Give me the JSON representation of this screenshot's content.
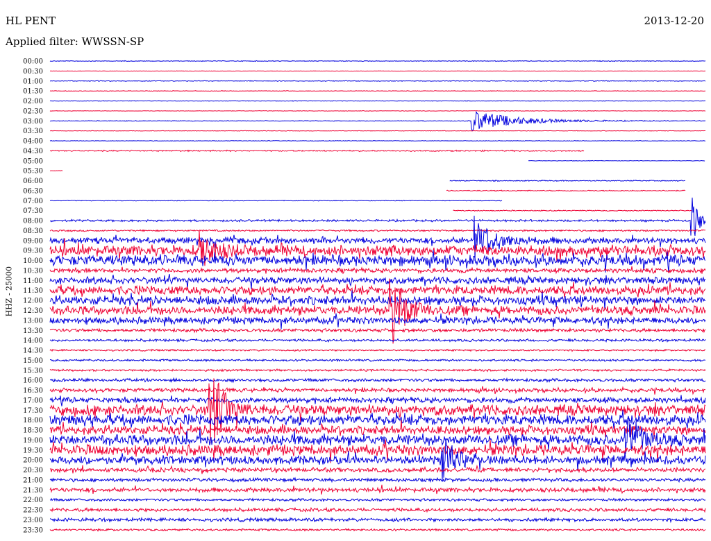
{
  "header": {
    "station": "HL PENT",
    "date": "2013-12-20",
    "filter": "Applied filter: WWSSN-SP"
  },
  "chart_data": {
    "type": "helicorder",
    "ylabel": "HHZ - 25000",
    "colors": {
      "even": "#0000dd",
      "odd": "#ee0033"
    },
    "rows": [
      {
        "label": "00:00",
        "start": 0.0,
        "end": 1.0,
        "level": 0.4
      },
      {
        "label": "00:30",
        "start": 0.0,
        "end": 1.0,
        "level": 0.2
      },
      {
        "label": "01:00",
        "start": 0.0,
        "end": 1.0,
        "level": 0.4
      },
      {
        "label": "01:30",
        "start": 0.0,
        "end": 1.0,
        "level": 0.3
      },
      {
        "label": "02:00",
        "start": 0.0,
        "end": 1.0,
        "level": 0.3
      },
      {
        "label": "02:30",
        "start": 0.0,
        "end": 1.0,
        "level": 0.3
      },
      {
        "label": "03:00",
        "start": 0.0,
        "end": 1.0,
        "level": 0.4
      },
      {
        "label": "03:30",
        "start": 0.0,
        "end": 1.0,
        "level": 0.3
      },
      {
        "label": "04:00",
        "start": 0.0,
        "end": 1.0,
        "level": 0.3
      },
      {
        "label": "04:30",
        "start": 0.0,
        "end": 0.815,
        "level": 0.8
      },
      {
        "label": "05:00",
        "start": 0.73,
        "end": 1.0,
        "level": 0.3
      },
      {
        "label": "05:30",
        "start": 0.0,
        "end": 0.02,
        "level": 0.3
      },
      {
        "label": "06:00",
        "start": 0.61,
        "end": 0.97,
        "level": 0.6
      },
      {
        "label": "06:30",
        "start": 0.605,
        "end": 0.97,
        "level": 0.6
      },
      {
        "label": "07:00",
        "start": 0.0,
        "end": 0.69,
        "level": 0.4
      },
      {
        "label": "07:30",
        "start": 0.615,
        "end": 0.98,
        "level": 0.6
      },
      {
        "label": "08:00",
        "start": 0.0,
        "end": 1.0,
        "level": 1.2
      },
      {
        "label": "08:30",
        "start": 0.0,
        "end": 1.0,
        "level": 1.0
      },
      {
        "label": "09:00",
        "start": 0.0,
        "end": 1.0,
        "level": 3.5
      },
      {
        "label": "09:30",
        "start": 0.0,
        "end": 1.0,
        "level": 6.0
      },
      {
        "label": "10:00",
        "start": 0.0,
        "end": 1.0,
        "level": 6.0
      },
      {
        "label": "10:30",
        "start": 0.0,
        "end": 1.0,
        "level": 2.5
      },
      {
        "label": "11:00",
        "start": 0.0,
        "end": 1.0,
        "level": 4.0
      },
      {
        "label": "11:30",
        "start": 0.0,
        "end": 1.0,
        "level": 5.0
      },
      {
        "label": "12:00",
        "start": 0.0,
        "end": 1.0,
        "level": 5.0
      },
      {
        "label": "12:30",
        "start": 0.0,
        "end": 1.0,
        "level": 5.0
      },
      {
        "label": "13:00",
        "start": 0.0,
        "end": 1.0,
        "level": 4.0
      },
      {
        "label": "13:30",
        "start": 0.0,
        "end": 1.0,
        "level": 2.0
      },
      {
        "label": "14:00",
        "start": 0.0,
        "end": 1.0,
        "level": 1.5
      },
      {
        "label": "14:30",
        "start": 0.0,
        "end": 1.0,
        "level": 1.0
      },
      {
        "label": "15:00",
        "start": 0.0,
        "end": 1.0,
        "level": 1.2
      },
      {
        "label": "15:30",
        "start": 0.0,
        "end": 1.0,
        "level": 1.2
      },
      {
        "label": "16:00",
        "start": 0.0,
        "end": 1.0,
        "level": 1.8
      },
      {
        "label": "16:30",
        "start": 0.0,
        "end": 1.0,
        "level": 2.2
      },
      {
        "label": "17:00",
        "start": 0.0,
        "end": 1.0,
        "level": 3.0
      },
      {
        "label": "17:30",
        "start": 0.0,
        "end": 1.0,
        "level": 6.0
      },
      {
        "label": "18:00",
        "start": 0.0,
        "end": 1.0,
        "level": 6.0
      },
      {
        "label": "18:30",
        "start": 0.0,
        "end": 1.0,
        "level": 5.0
      },
      {
        "label": "19:00",
        "start": 0.0,
        "end": 1.0,
        "level": 6.0
      },
      {
        "label": "19:30",
        "start": 0.0,
        "end": 1.0,
        "level": 6.0
      },
      {
        "label": "20:00",
        "start": 0.0,
        "end": 1.0,
        "level": 5.0
      },
      {
        "label": "20:30",
        "start": 0.0,
        "end": 1.0,
        "level": 2.5
      },
      {
        "label": "21:00",
        "start": 0.0,
        "end": 1.0,
        "level": 2.0
      },
      {
        "label": "21:30",
        "start": 0.0,
        "end": 1.0,
        "level": 2.5
      },
      {
        "label": "22:00",
        "start": 0.0,
        "end": 1.0,
        "level": 1.5
      },
      {
        "label": "22:30",
        "start": 0.0,
        "end": 1.0,
        "level": 2.0
      },
      {
        "label": "23:00",
        "start": 0.0,
        "end": 1.0,
        "level": 2.0
      },
      {
        "label": "23:30",
        "start": 0.0,
        "end": 1.0,
        "level": 1.2
      }
    ],
    "events": [
      {
        "row": 6,
        "at": 0.645,
        "amp": 16,
        "decay": 0.06
      },
      {
        "row": 16,
        "at": 0.98,
        "amp": 35,
        "decay": 0.01
      },
      {
        "row": 18,
        "at": 0.65,
        "amp": 28,
        "decay": 0.03
      },
      {
        "row": 19,
        "at": 0.23,
        "amp": 25,
        "decay": 0.02
      },
      {
        "row": 25,
        "at": 0.52,
        "amp": 60,
        "decay": 0.02
      },
      {
        "row": 35,
        "at": 0.245,
        "amp": 60,
        "decay": 0.02
      },
      {
        "row": 38,
        "at": 0.88,
        "amp": 40,
        "decay": 0.02
      },
      {
        "row": 40,
        "at": 0.6,
        "amp": 30,
        "decay": 0.02
      }
    ]
  }
}
